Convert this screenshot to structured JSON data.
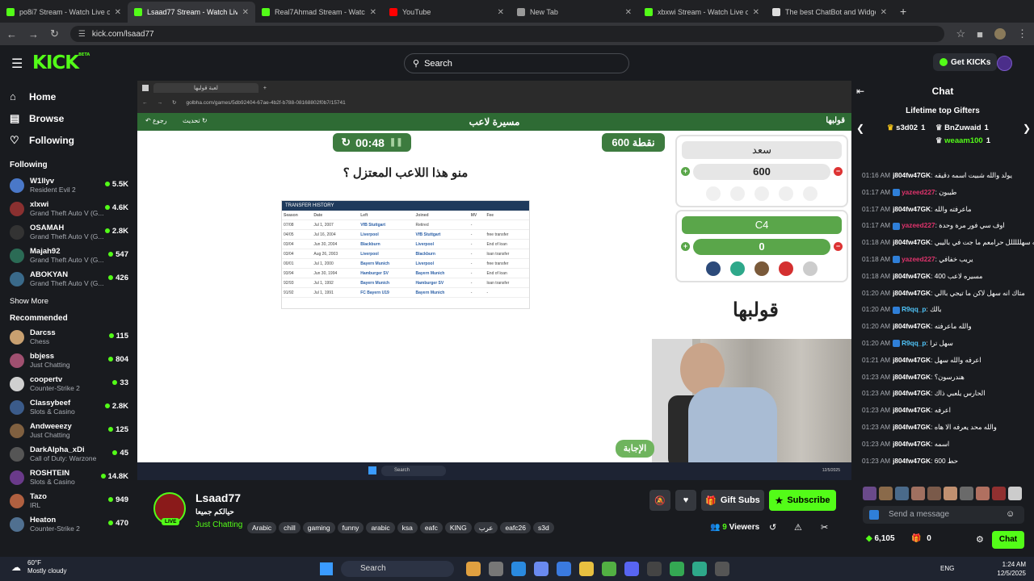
{
  "browser": {
    "tabs": [
      {
        "title": "po8i7 Stream - Watch Live on Ki...",
        "icon_color": "#53fc18"
      },
      {
        "title": "Lsaad77 Stream - Watch Live on...",
        "icon_color": "#53fc18",
        "active": true
      },
      {
        "title": "Real7Ahmad Stream - Watch Li...",
        "icon_color": "#53fc18"
      },
      {
        "title": "YouTube",
        "icon_color": "#ff0000"
      },
      {
        "title": "New Tab",
        "icon_color": "#999999"
      },
      {
        "title": "xbxwi Stream - Watch Live on Ki...",
        "icon_color": "#53fc18"
      },
      {
        "title": "The best ChatBot and Widgets f...",
        "icon_color": "#dddddd"
      }
    ],
    "url": "kick.com/lsaad77"
  },
  "header": {
    "logo": "KICK",
    "logo_sup": "BETA",
    "search_placeholder": "Search",
    "get_kicks": "Get KICKs"
  },
  "sidebar": {
    "nav": [
      {
        "label": "Home",
        "icon": "home-icon"
      },
      {
        "label": "Browse",
        "icon": "browse-icon"
      },
      {
        "label": "Following",
        "icon": "heart-icon"
      }
    ],
    "following_title": "Following",
    "following": [
      {
        "name": "W1llyv",
        "category": "Resident Evil 2",
        "viewers": "5.5K",
        "color": "#4a78c8"
      },
      {
        "name": "xlxwi",
        "category": "Grand Theft Auto V (G...",
        "viewers": "4.6K",
        "color": "#8a3030"
      },
      {
        "name": "OSAMAH",
        "category": "Grand Theft Auto V (G...",
        "viewers": "2.8K",
        "color": "#333333"
      },
      {
        "name": "Majah92",
        "category": "Grand Theft Auto V (G...",
        "viewers": "547",
        "color": "#2b6b55"
      },
      {
        "name": "ABOKYAN",
        "category": "Grand Theft Auto V (G...",
        "viewers": "426",
        "color": "#3a6a8a"
      }
    ],
    "show_more": "Show More",
    "recommended_title": "Recommended",
    "recommended": [
      {
        "name": "Darcss",
        "category": "Chess",
        "viewers": "115",
        "color": "#c8a070"
      },
      {
        "name": "bbjess",
        "category": "Just Chatting",
        "viewers": "804",
        "color": "#a05070"
      },
      {
        "name": "coopertv",
        "category": "Counter-Strike 2",
        "viewers": "33",
        "color": "#d0d0d0"
      },
      {
        "name": "Classybeef",
        "category": "Slots & Casino",
        "viewers": "2.8K",
        "color": "#3b5b8a"
      },
      {
        "name": "Andweeezy",
        "category": "Just Chatting",
        "viewers": "125",
        "color": "#806040"
      },
      {
        "name": "DarkAlpha_xDi",
        "category": "Call of Duty: Warzone",
        "viewers": "45",
        "color": "#555555"
      },
      {
        "name": "ROSHTEIN",
        "category": "Slots & Casino",
        "viewers": "14.8K",
        "color": "#6a3a8a"
      },
      {
        "name": "Tazo",
        "category": "IRL",
        "viewers": "949",
        "color": "#b06040"
      },
      {
        "name": "Heaton",
        "category": "Counter-Strike 2",
        "viewers": "470",
        "color": "#507090"
      }
    ]
  },
  "stream": {
    "inner_url": "golbha.com/games/5db92404-67ae-4b2f-b788-08168802f0b7/15741",
    "inner_tab": "لعبة قولبها",
    "game_title": "مسيرة لاعب",
    "back_label": "رجوع",
    "refresh_label": "تحديث",
    "brand_small": "قولبها",
    "timer": "00:48",
    "points": "600 نقطة",
    "question": "منو هذا اللاعب المعتزل ؟",
    "transfer_history": {
      "title": "TRANSFER HISTORY",
      "columns": [
        "Season",
        "Date",
        "Left",
        "Joined",
        "MV",
        "Fee"
      ],
      "rows": [
        [
          "07/08",
          "Jul 1, 2007",
          "VfB Stuttgart",
          "Retired",
          "-",
          ""
        ],
        [
          "04/05",
          "Jul 16, 2004",
          "Liverpool",
          "VfB Stuttgart",
          "-",
          "free transfer"
        ],
        [
          "03/04",
          "Jun 30, 2004",
          "Blackburn",
          "Liverpool",
          "-",
          "End of loan"
        ],
        [
          "03/04",
          "Aug 26, 2003",
          "Liverpool",
          "Blackburn",
          "-",
          "loan transfer"
        ],
        [
          "00/01",
          "Jul 1, 2000",
          "Bayern Munich",
          "Liverpool",
          "-",
          "free transfer"
        ],
        [
          "93/94",
          "Jun 30, 1994",
          "Hamburger SV",
          "Bayern Munich",
          "-",
          "End of loan"
        ],
        [
          "92/93",
          "Jul 1, 1992",
          "Bayern Munich",
          "Hamburger SV",
          "-",
          "loan transfer"
        ],
        [
          "91/92",
          "Jul 1, 1991",
          "FC Bayern U19",
          "Bayern Munich",
          "-",
          "-"
        ]
      ]
    },
    "player1": {
      "name": "سعد",
      "score": "600"
    },
    "player2": {
      "name": "C4",
      "score": "0"
    },
    "brand": "قولبها",
    "answer_button": "الإجابة",
    "inner_taskbar_search": "Search",
    "inner_taskbar_date": "12/5/2025"
  },
  "channel": {
    "name": "Lsaad77",
    "live": "LIVE",
    "title": "حيالكم جميعا",
    "category": "Just Chatting",
    "tags": [
      "Arabic",
      "chill",
      "gaming",
      "funny",
      "arabic",
      "ksa",
      "eafc",
      "KING",
      "عرب",
      "eafc26",
      "s3d"
    ],
    "viewers": "9",
    "viewers_label": "Viewers",
    "gift_subs": "Gift Subs",
    "subscribe": "Subscribe"
  },
  "chat": {
    "title": "Chat",
    "gifters_title": "Lifetime top Gifters",
    "gifters": [
      {
        "name": "s3d02",
        "count": "1"
      },
      {
        "name": "BnZuwaid",
        "count": "1"
      },
      {
        "name": "weaam100",
        "count": "1"
      }
    ],
    "messages": [
      {
        "time": "01:16 AM",
        "user": "j804fw47GK",
        "color": "#ffffff",
        "text": "يولد والله شبيت اسمه دقيقه"
      },
      {
        "time": "01:17 AM",
        "user": "yazeed227",
        "color": "#e0336c",
        "text": "طيبون"
      },
      {
        "time": "01:17 AM",
        "user": "j804fw47GK",
        "color": "#ffffff",
        "text": "ماعرفته والله"
      },
      {
        "time": "01:17 AM",
        "user": "yazeed227",
        "color": "#e0336c",
        "text": "اوف سي فور مرة وحدة"
      },
      {
        "time": "01:18 AM",
        "user": "j804fw47GK",
        "color": "#ffffff",
        "text": "والله سهلللللل حرامعم ما جت في باليبي"
      },
      {
        "time": "01:18 AM",
        "user": "yazeed227",
        "color": "#e0336c",
        "text": "يريب خفافي"
      },
      {
        "time": "01:18 AM",
        "user": "j804fw47GK",
        "color": "#ffffff",
        "text": "مسيره لاعب 400"
      },
      {
        "time": "01:20 AM",
        "user": "j804fw47GK",
        "color": "#ffffff",
        "text": "متاك انه سهل لاكن ما تيجي باالي"
      },
      {
        "time": "01:20 AM",
        "user": "R9qq_p",
        "color": "#4fc3f7",
        "text": "بالك"
      },
      {
        "time": "01:20 AM",
        "user": "j804fw47GK",
        "color": "#ffffff",
        "text": "والله ماعرفته"
      },
      {
        "time": "01:20 AM",
        "user": "R9qq_p",
        "color": "#4fc3f7",
        "text": "سهل ترا"
      },
      {
        "time": "01:21 AM",
        "user": "j804fw47GK",
        "color": "#ffffff",
        "text": "اعرفه والله سهل"
      },
      {
        "time": "01:23 AM",
        "user": "j804fw47GK",
        "color": "#ffffff",
        "text": "هندرسون؟"
      },
      {
        "time": "01:23 AM",
        "user": "j804fw47GK",
        "color": "#ffffff",
        "text": "الحارس يلعبي ذاك"
      },
      {
        "time": "01:23 AM",
        "user": "j804fw47GK",
        "color": "#ffffff",
        "text": "اعرفه"
      },
      {
        "time": "01:23 AM",
        "user": "j804fw47GK",
        "color": "#ffffff",
        "text": "والله محد يعرفه الا هاه"
      },
      {
        "time": "01:23 AM",
        "user": "j804fw47GK",
        "color": "#ffffff",
        "text": "اسمه"
      },
      {
        "time": "01:23 AM",
        "user": "j804fw47GK",
        "color": "#ffffff",
        "text": "حط 600"
      }
    ],
    "send_placeholder": "Send a message",
    "kicks_balance": "6,105",
    "gift_count": "0",
    "chat_button": "Chat"
  },
  "taskbar": {
    "weather_temp": "60°F",
    "weather_desc": "Mostly cloudy",
    "search": "Search",
    "lang": "ENG",
    "time": "1:24 AM",
    "date": "12/5/2025"
  }
}
